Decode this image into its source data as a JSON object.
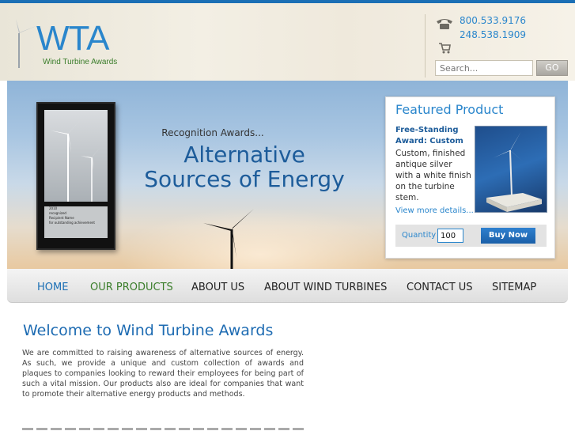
{
  "brand": {
    "logo_text": "WTA",
    "tagline": "Wind Turbine Awards"
  },
  "header": {
    "phone_primary": "800.533.9176",
    "phone_secondary": "248.538.1909",
    "search_placeholder": "Search...",
    "search_button": "GO"
  },
  "hero": {
    "kicker": "Recognition Awards...",
    "title_line1": "Alternative",
    "title_line2": "Sources of Energy",
    "plaque_lines": [
      "2010",
      "recognized",
      "Recipient Name",
      "for outstanding achievement"
    ]
  },
  "featured": {
    "heading": "Featured Product",
    "product_name_line1": "Free-Standing",
    "product_name_line2": "Award: Custom",
    "description": "Custom, finished antique silver with a white finish on the turbine stem.",
    "more_link": "View more details...",
    "quantity_label": "Quantity",
    "quantity_value": "100",
    "buy_button": "Buy Now"
  },
  "nav": {
    "items": [
      {
        "label": "HOME",
        "state": "active"
      },
      {
        "label": "OUR PRODUCTS",
        "state": "current"
      },
      {
        "label": "ABOUT US",
        "state": "normal"
      },
      {
        "label": "ABOUT WIND TURBINES",
        "state": "normal"
      },
      {
        "label": "CONTACT US",
        "state": "normal"
      },
      {
        "label": "SITEMAP",
        "state": "normal"
      }
    ]
  },
  "content": {
    "heading": "Welcome to Wind Turbine Awards",
    "paragraph": "We are committed to raising awareness of alternative sources of energy. As such, we provide a unique and custom collection of awards and plaques to companies looking to reward their employees for being part of such a vital mission. Our products also are ideal for companies that want to promote their alternative energy products and methods."
  },
  "colors": {
    "brand_blue": "#2a86cc",
    "brand_green": "#3a7d2a",
    "buy_blue": "#1a5fa8"
  }
}
